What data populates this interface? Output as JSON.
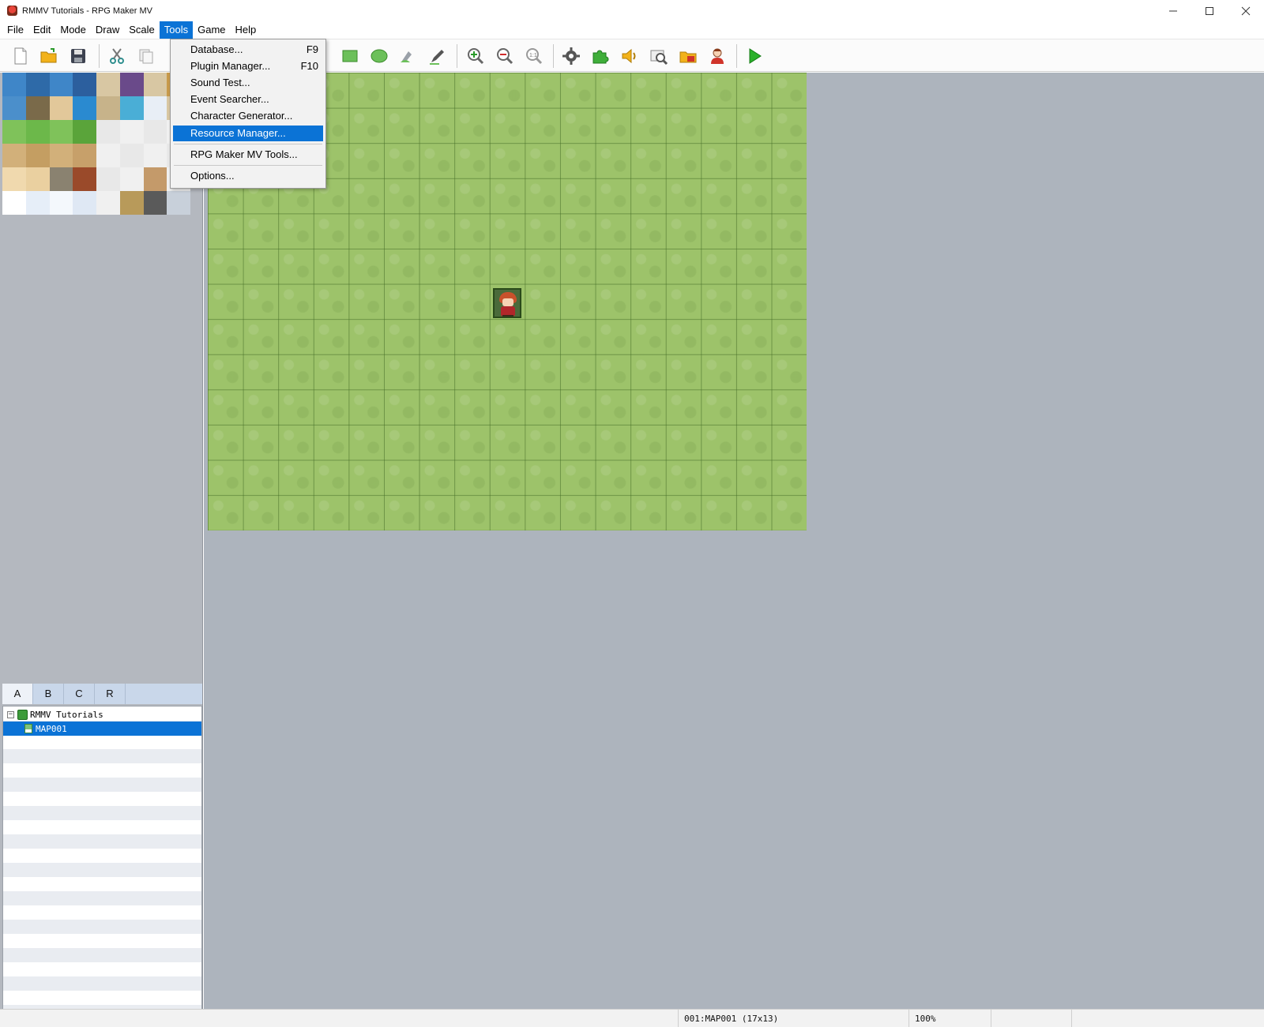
{
  "window": {
    "title": "RMMV Tutorials - RPG Maker MV",
    "minimize_icon": "minimize-icon",
    "maximize_icon": "maximize-icon",
    "close_icon": "close-icon"
  },
  "menubar": {
    "items": [
      "File",
      "Edit",
      "Mode",
      "Draw",
      "Scale",
      "Tools",
      "Game",
      "Help"
    ],
    "active": "Tools"
  },
  "tools_menu": {
    "items": [
      {
        "label": "Database...",
        "shortcut": "F9"
      },
      {
        "label": "Plugin Manager...",
        "shortcut": "F10"
      },
      {
        "label": "Sound Test...",
        "shortcut": ""
      },
      {
        "label": "Event Searcher...",
        "shortcut": ""
      },
      {
        "label": "Character Generator...",
        "shortcut": ""
      },
      {
        "label": "Resource Manager...",
        "shortcut": ""
      },
      {
        "label": "RPG Maker MV Tools...",
        "shortcut": ""
      },
      {
        "label": "Options...",
        "shortcut": ""
      }
    ],
    "selected": "Resource Manager..."
  },
  "toolbar": {
    "icons": [
      "new-project-icon",
      "open-project-icon",
      "save-project-icon",
      "cut-icon",
      "copy-icon",
      "rectangle-icon",
      "ellipse-icon",
      "flood-fill-icon",
      "pencil-icon",
      "zoom-in-icon",
      "zoom-out-icon",
      "actual-size-icon",
      "database-icon",
      "plugin-manager-icon",
      "sound-test-icon",
      "event-searcher-icon",
      "resource-manager-icon",
      "character-generator-icon",
      "playtest-icon"
    ]
  },
  "tileset_tabs": [
    "A",
    "B",
    "C",
    "R"
  ],
  "active_tab": "A",
  "map_tree": {
    "project": "RMMV Tutorials",
    "maps": [
      "MAP001"
    ],
    "selected": "MAP001"
  },
  "statusbar": {
    "map_info": "001:MAP001 (17x13)",
    "zoom": "100%"
  },
  "colors": {
    "accent": "#0b73d6",
    "grass": "#9dc36a",
    "map_background": "#adb4bd",
    "panel_background": "#b4b8bf"
  }
}
